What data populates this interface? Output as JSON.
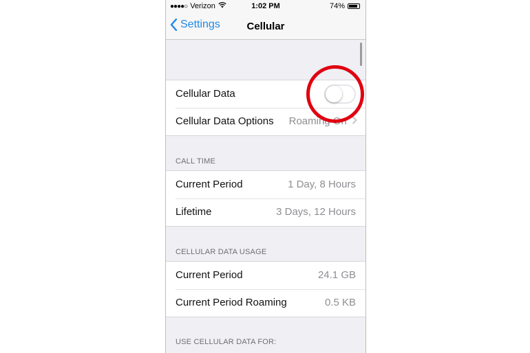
{
  "status_bar": {
    "carrier": "Verizon",
    "time": "1:02 PM",
    "battery": "74%"
  },
  "nav": {
    "back_label": "Settings",
    "title": "Cellular"
  },
  "cellular_group": {
    "cellular_data": {
      "label": "Cellular Data",
      "toggle_on": false
    },
    "cellular_data_options": {
      "label": "Cellular Data Options",
      "value": "Roaming On"
    }
  },
  "call_time": {
    "header": "CALL TIME",
    "rows": [
      {
        "label": "Current Period",
        "value": "1 Day, 8 Hours"
      },
      {
        "label": "Lifetime",
        "value": "3 Days, 12 Hours"
      }
    ]
  },
  "data_usage": {
    "header": "CELLULAR DATA USAGE",
    "rows": [
      {
        "label": "Current Period",
        "value": "24.1 GB"
      },
      {
        "label": "Current Period Roaming",
        "value": "0.5 KB"
      }
    ]
  },
  "use_data_for": {
    "header": "USE CELLULAR DATA FOR:"
  },
  "colors": {
    "accent": "#1e88e5",
    "annotation": "#e00010",
    "background": "#efeff4"
  }
}
